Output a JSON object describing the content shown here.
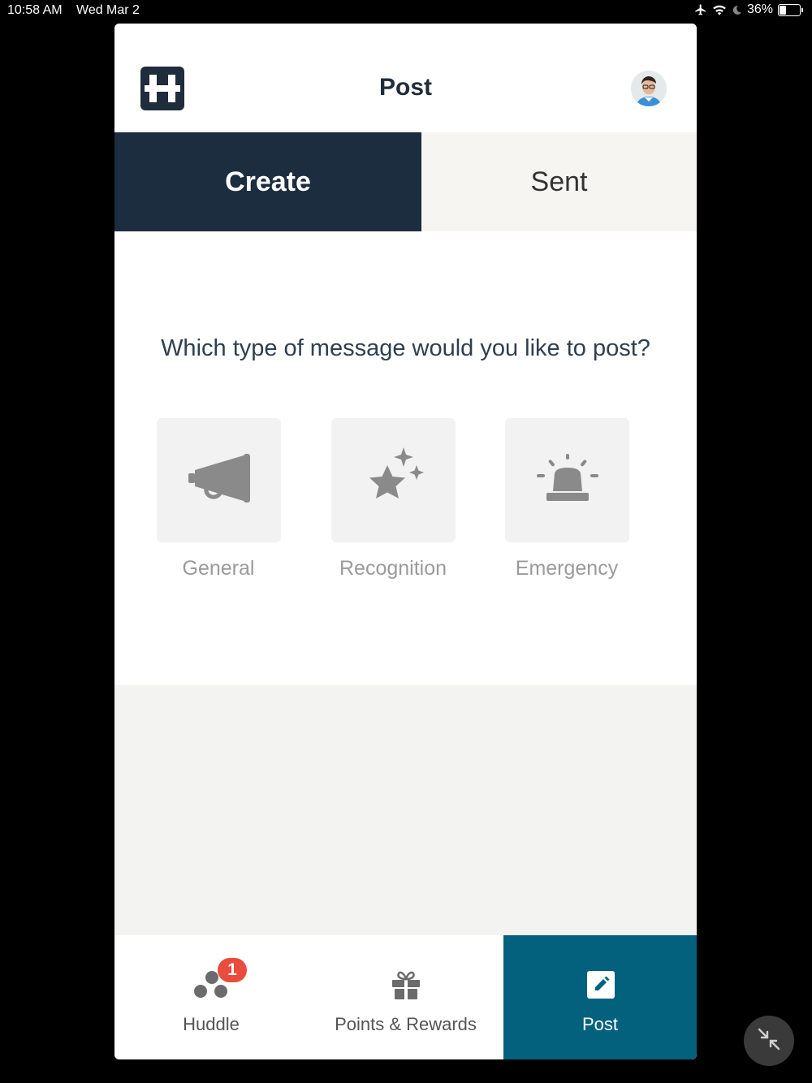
{
  "status_bar": {
    "time": "10:58 AM",
    "date": "Wed Mar 2",
    "battery": "36%",
    "battery_level": 0.36,
    "icons": [
      "airplane-icon",
      "wifi-icon",
      "moon-icon",
      "battery-icon"
    ]
  },
  "header": {
    "title": "Post",
    "logo_icon": "h-logo-icon",
    "avatar_icon": "user-avatar"
  },
  "tabs": [
    {
      "label": "Create",
      "active": true
    },
    {
      "label": "Sent",
      "active": false
    }
  ],
  "main": {
    "question": "Which type of message would you like to post?",
    "options": [
      {
        "label": "General",
        "icon": "megaphone-icon"
      },
      {
        "label": "Recognition",
        "icon": "star-sparkle-icon"
      },
      {
        "label": "Emergency",
        "icon": "siren-icon"
      }
    ]
  },
  "bottom_nav": {
    "items": [
      {
        "label": "Huddle",
        "icon": "huddle-dots-icon",
        "badge": "1"
      },
      {
        "label": "Points & Rewards",
        "icon": "gift-icon"
      },
      {
        "label": "Post",
        "icon": "edit-icon",
        "active": true
      }
    ]
  },
  "colors": {
    "navy": "#1d2d40",
    "teal": "#03617d",
    "badge_red": "#e94b3c",
    "icon_grey": "#8a8a8a"
  }
}
